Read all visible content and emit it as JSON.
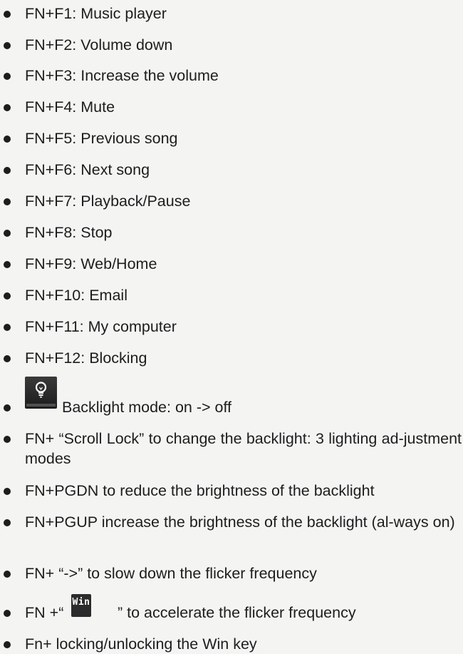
{
  "items": [
    {
      "text": "FN+F1: Music player"
    },
    {
      "text": "FN+F2: Volume down"
    },
    {
      "text": "FN+F3: Increase the volume"
    },
    {
      "text": "FN+F4: Mute"
    },
    {
      "text": "FN+F5: Previous song"
    },
    {
      "text": "FN+F6: Next song"
    },
    {
      "text": "FN+F7: Playback/Pause"
    },
    {
      "text": "FN+F8: Stop"
    },
    {
      "text": "FN+F9: Web/Home"
    },
    {
      "text": "FN+F10: Email"
    },
    {
      "text": "FN+F11: My computer"
    },
    {
      "text": "FN+F12: Blocking"
    },
    {
      "icon": "lightbulb-icon",
      "text": "Backlight mode: on -> off"
    },
    {
      "text": "FN+ “Scroll Lock” to change the backlight: 3 lighting ad-justment modes"
    },
    {
      "text": "FN+PGDN to reduce the brightness of the backlight"
    },
    {
      "text": "FN+PGUP increase the brightness of the backlight (al-ways on)"
    },
    {
      "text": "FN+ “->” to slow down the flicker frequency"
    },
    {
      "prefix": "FN +“",
      "key": "Win",
      "suffix": " ” to accelerate the flicker frequency"
    },
    {
      "text": "Fn+ locking/unlocking the Win key"
    }
  ],
  "colors": {
    "background": "#f4f4f2",
    "text": "#1d1d1d",
    "keycap": "#2b2b2b"
  }
}
